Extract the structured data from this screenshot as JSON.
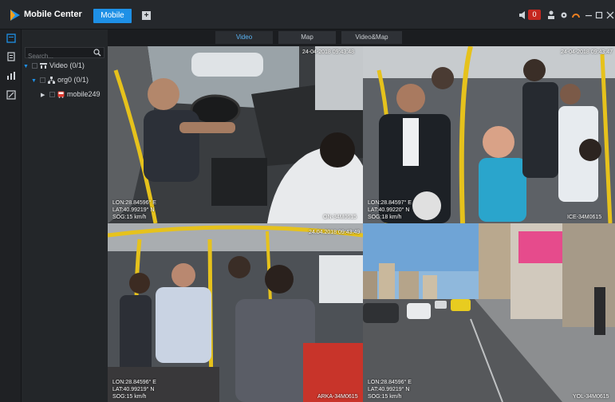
{
  "app": {
    "title": "Mobile Center",
    "mode_button": "Mobile",
    "add_tab": "+",
    "alarm_count": "0"
  },
  "accent": "#1e90e6",
  "tree": {
    "search_placeholder": "Search...",
    "nodes": [
      {
        "label": "Video (0/1)"
      },
      {
        "label": "org0 (0/1)"
      },
      {
        "label": "mobile249"
      }
    ]
  },
  "tabs": [
    {
      "label": "Video"
    },
    {
      "label": "Map"
    },
    {
      "label": "Video&Map"
    }
  ],
  "cells": [
    {
      "timestamp": "24-04-2018 09:43:48",
      "lon": "LON:28.84596° E",
      "lat": "LAT:40.99219° N",
      "sog": "SOG:15 km/h",
      "camera": "ON-34M0615"
    },
    {
      "timestamp": "24-04-2018 09:43:47",
      "lon": "LON:28.84597° E",
      "lat": "LAT:40.99220° N",
      "sog": "SOG:18 km/h",
      "camera": "ICE-34M0615"
    },
    {
      "timestamp": "24.04.2018 09:43:49",
      "lon": "LON:28.84596° E",
      "lat": "LAT:40.99219° N",
      "sog": "SOG:15 km/h",
      "camera": "ARKA-34M0615"
    },
    {
      "timestamp": "",
      "lon": "LON:28.84596° E",
      "lat": "LAT:40.99219° N",
      "sog": "SOG:15 km/h",
      "camera": "YOL-34M0615"
    }
  ]
}
